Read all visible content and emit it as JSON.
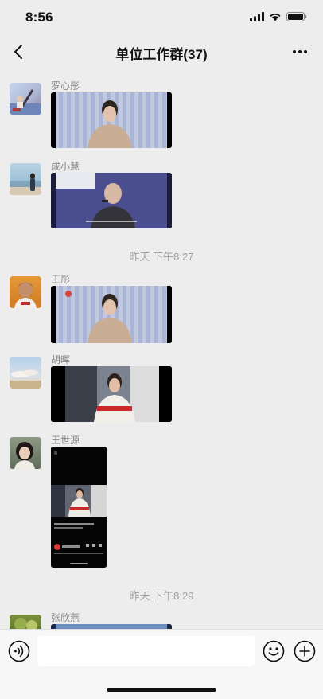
{
  "status_bar": {
    "time": "8:56"
  },
  "nav": {
    "title": "单位工作群(37)"
  },
  "messages": [
    {
      "sender": "罗心彤"
    },
    {
      "sender": "成小慧"
    },
    {
      "sender": "王彤"
    },
    {
      "sender": "胡晖"
    },
    {
      "sender": "王世源"
    },
    {
      "sender": "张欣燕"
    }
  ],
  "timestamps": [
    "昨天 下午8:27",
    "昨天 下午8:29"
  ],
  "input": {
    "placeholder": ""
  },
  "icons": {
    "back": "chevron-left-icon",
    "more": "more-dots-icon",
    "voice": "voice-icon",
    "emoji": "emoji-icon",
    "plus": "plus-icon"
  },
  "colors": {
    "background": "#ededed",
    "input_bar": "#f7f7f7",
    "timestamp": "#a0a0a0",
    "sender": "#888888"
  }
}
